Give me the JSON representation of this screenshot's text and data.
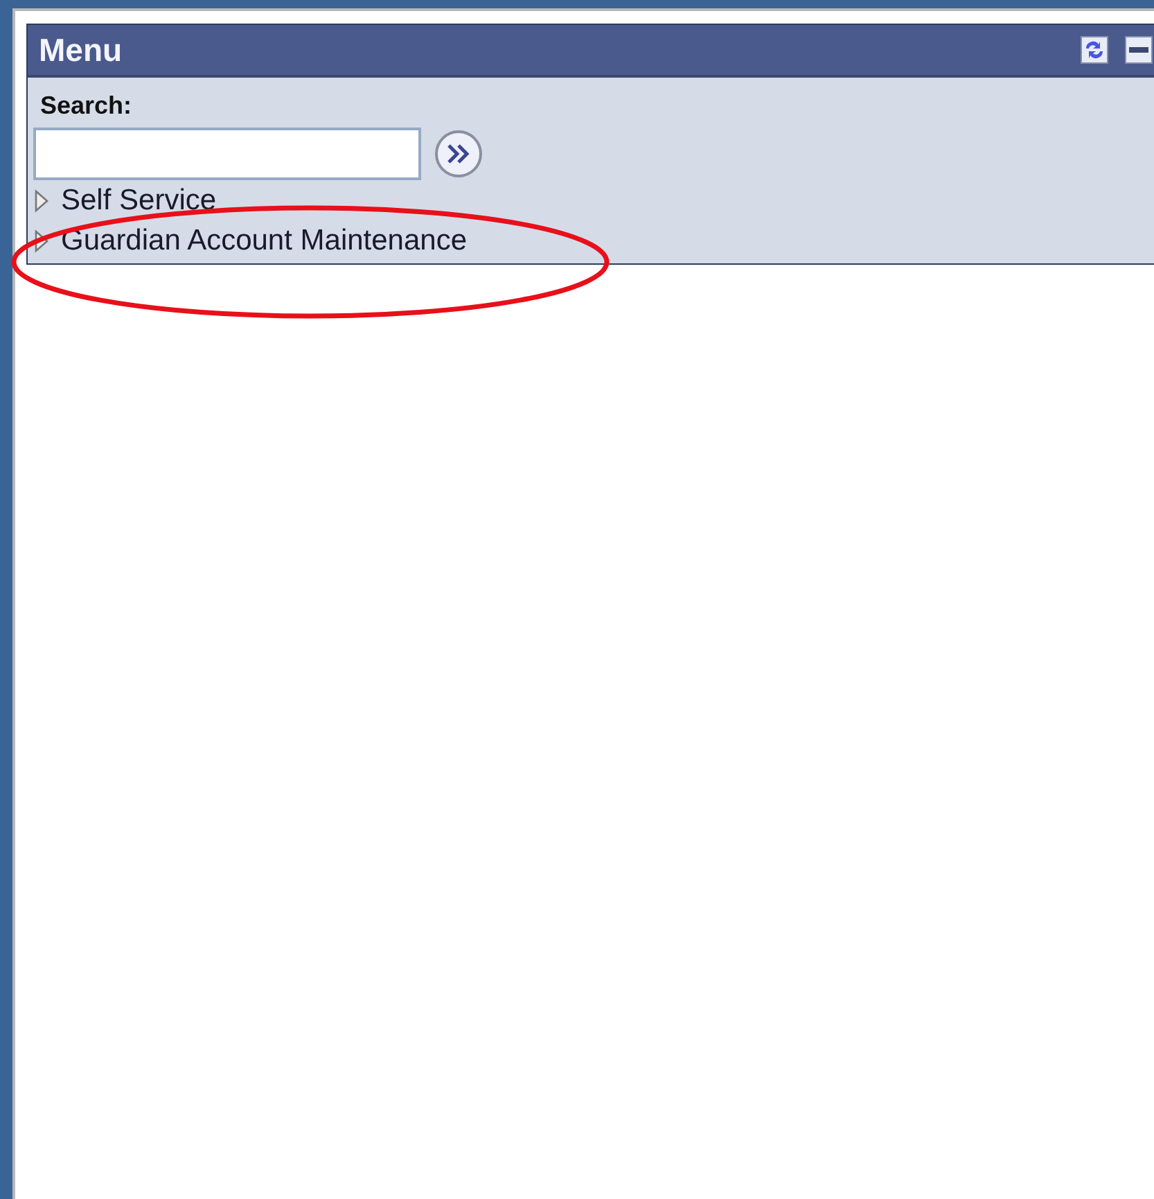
{
  "panel": {
    "title": "Menu"
  },
  "search": {
    "label": "Search:"
  },
  "menu_items": [
    {
      "label": "Self Service",
      "expanded": false
    },
    {
      "label": "Guardian Account Maintenance",
      "expanded": false
    }
  ]
}
